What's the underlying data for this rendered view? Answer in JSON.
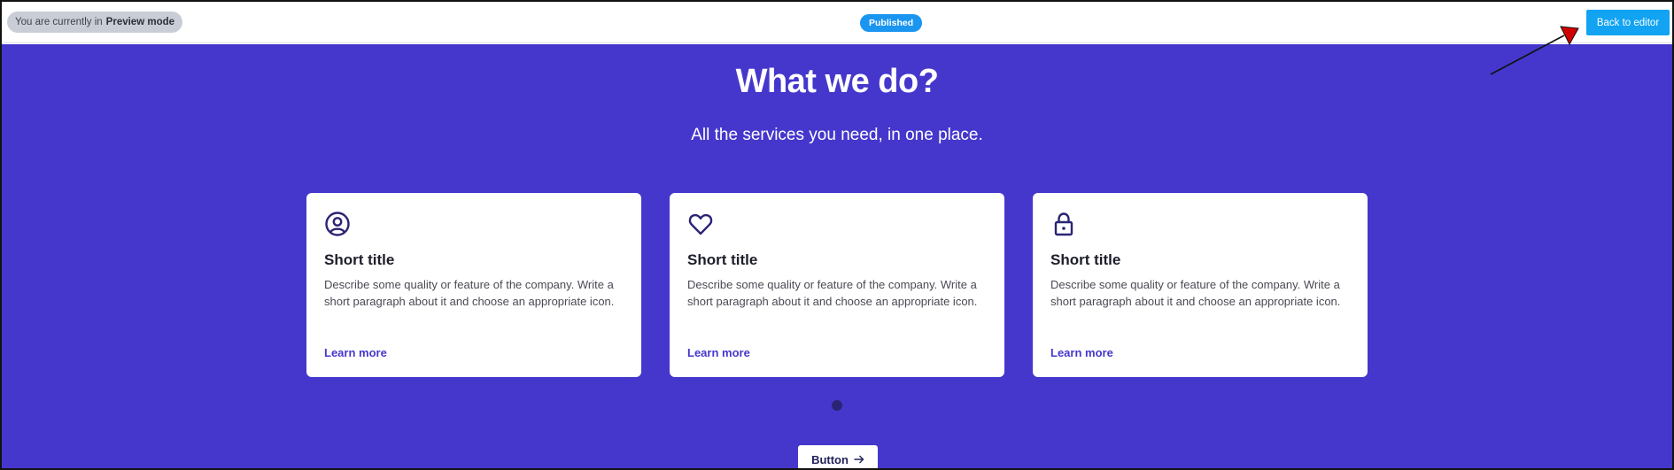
{
  "topbar": {
    "preview_prefix": "You are currently in",
    "preview_mode": "Preview mode",
    "status_badge": "Published",
    "back_button": "Back to editor"
  },
  "hero": {
    "title": "What we do?",
    "subtitle": "All the services you need, in one place."
  },
  "cards": [
    {
      "icon": "user-circle-icon",
      "title": "Short title",
      "text": "Describe some quality or feature of the company. Write a short paragraph about it and choose an appropriate icon.",
      "link": "Learn more"
    },
    {
      "icon": "heart-icon",
      "title": "Short title",
      "text": "Describe some quality or feature of the company. Write a short paragraph about it and choose an appropriate icon.",
      "link": "Learn more"
    },
    {
      "icon": "lock-icon",
      "title": "Short title",
      "text": "Describe some quality or feature of the company. Write a short paragraph about it and choose an appropriate icon.",
      "link": "Learn more"
    }
  ],
  "cta": {
    "label": "Button",
    "icon": "arrow-right-icon"
  },
  "colors": {
    "hero_bg": "#4537cc",
    "accent_blue": "#12a3f2",
    "icon_color": "#2b2475",
    "annotation_arrow": "#d10000"
  }
}
